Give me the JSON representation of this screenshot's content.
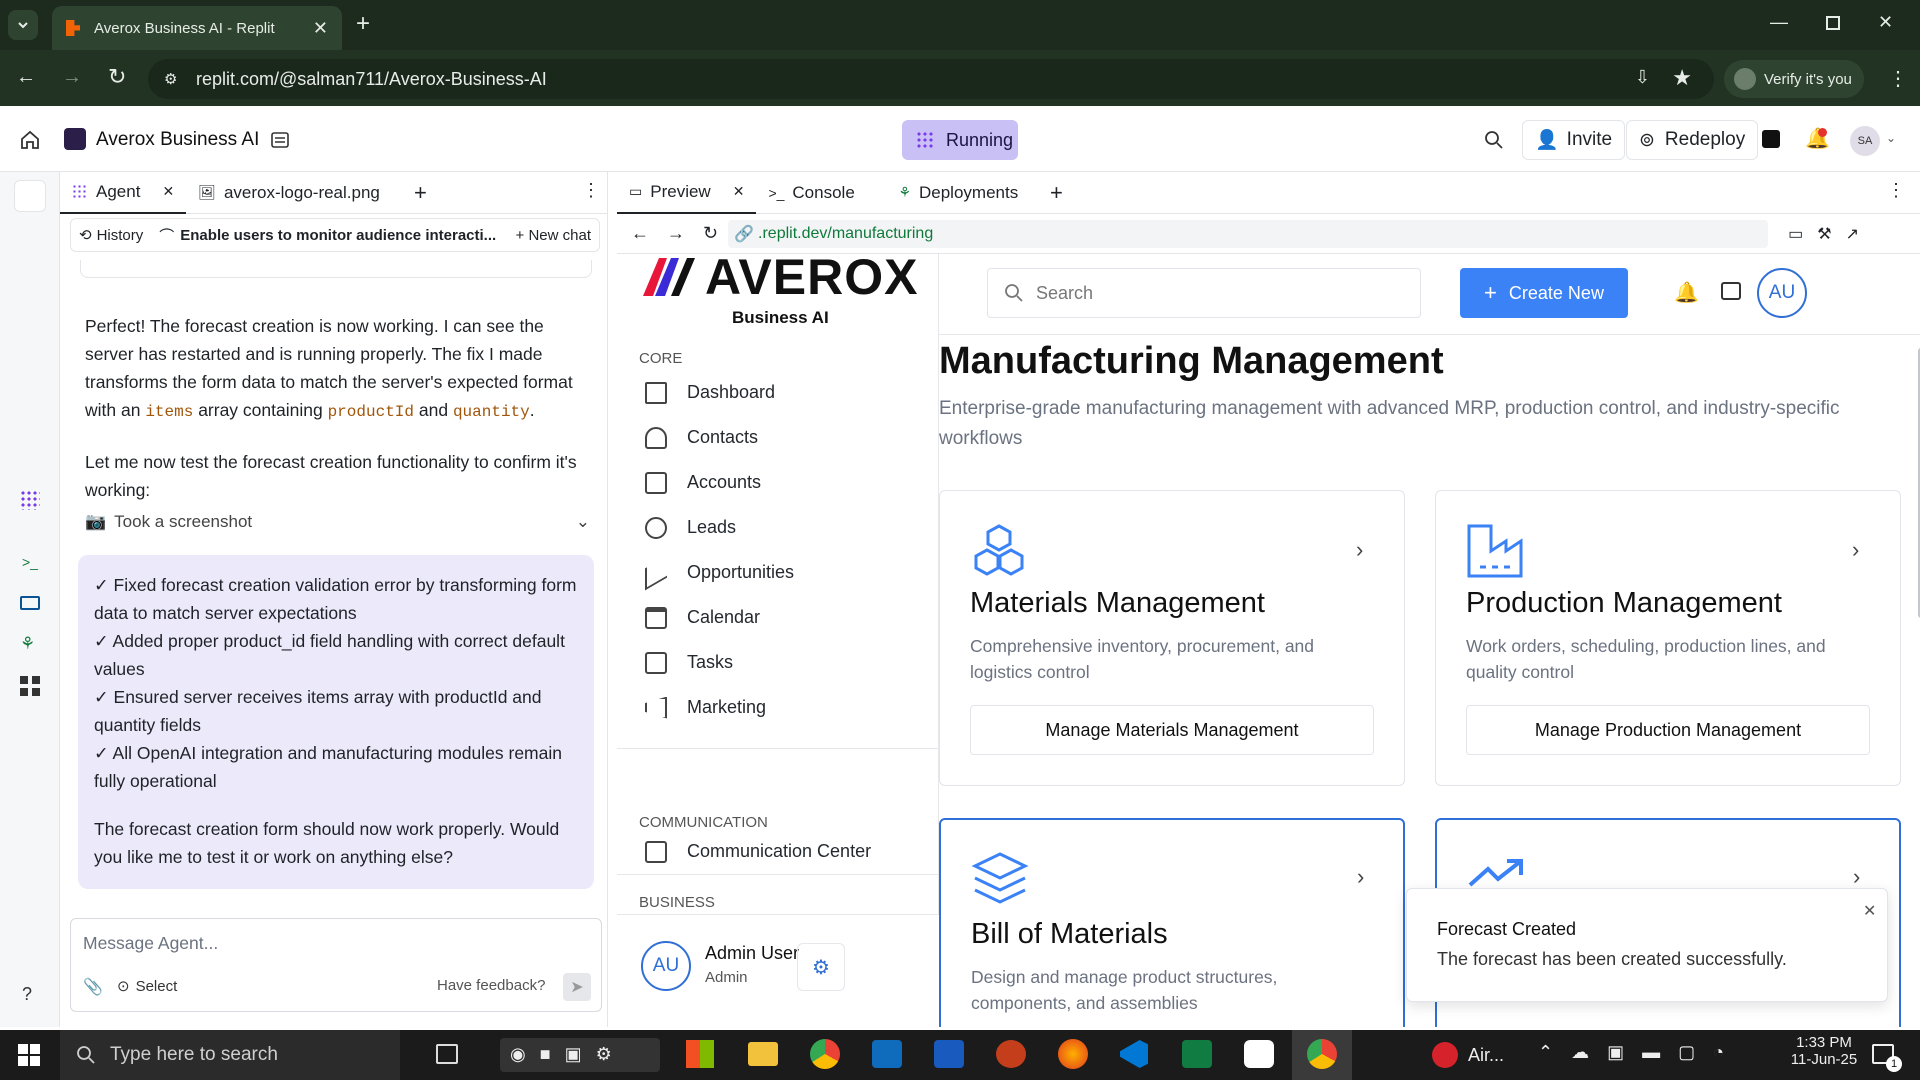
{
  "browser": {
    "tab_title": "Averox Business AI - Replit",
    "url": "replit.com/@salman711/Averox-Business-AI",
    "verify_label": "Verify it's you"
  },
  "replit_header": {
    "project_name": "Averox Business AI",
    "status": "Running",
    "invite_label": "Invite",
    "redeploy_label": "Redeploy",
    "avatar": "SA"
  },
  "agent_pane": {
    "tabs": [
      {
        "label": "Agent"
      },
      {
        "label": "averox-logo-real.png"
      }
    ],
    "history_label": "History",
    "thread_title": "Enable users to monitor audience interacti...",
    "new_chat_label": "New chat",
    "msg1_a": "Perfect! The forecast creation is now working. I can see the server has restarted and is running properly. The fix I made transforms the form data to match the server's expected format with an ",
    "code_items": "items",
    "msg1_b": " array containing ",
    "code_productId": "productId",
    "msg1_c": " and ",
    "code_quantity": "quantity",
    "msg1_d": ".",
    "msg2": "Let me now test the forecast creation functionality to confirm it's working:",
    "screenshot_label": "Took a screenshot",
    "checklist": [
      "✓ Fixed forecast creation validation error by transforming form data to match server expectations",
      "✓ Added proper product_id field handling with correct default values",
      "✓ Ensured server receives items array with productId and quantity fields",
      "✓ All OpenAI integration and manufacturing modules remain fully operational"
    ],
    "followup": "The forecast creation form should now work properly. Would you like me to test it or work on anything else?",
    "input_placeholder": "Message Agent...",
    "select_label": "Select",
    "feedback_label": "Have feedback?"
  },
  "preview_pane": {
    "tabs": [
      {
        "label": "Preview"
      },
      {
        "label": "Console"
      },
      {
        "label": "Deployments"
      }
    ],
    "url": ".replit.dev/manufacturing"
  },
  "app": {
    "logo_text": "AVEROX",
    "logo_sub": "Business AI",
    "sections": {
      "core": "CORE",
      "communication": "COMMUNICATION",
      "business": "BUSINESS"
    },
    "core_items": [
      {
        "label": "Dashboard",
        "icon": "dashboard-icon"
      },
      {
        "label": "Contacts",
        "icon": "users-icon"
      },
      {
        "label": "Accounts",
        "icon": "building-icon"
      },
      {
        "label": "Leads",
        "icon": "user-plus-icon"
      },
      {
        "label": "Opportunities",
        "icon": "trending-up-icon"
      },
      {
        "label": "Calendar",
        "icon": "calendar-icon"
      },
      {
        "label": "Tasks",
        "icon": "check-square-icon"
      },
      {
        "label": "Marketing",
        "icon": "megaphone-icon"
      }
    ],
    "comm_item": "Communication Center",
    "user": {
      "initials": "AU",
      "name": "Admin User",
      "role": "Admin"
    },
    "search_placeholder": "Search",
    "create_new": "Create New",
    "header_avatar": "AU",
    "page_title": "Manufacturing Management",
    "page_subtitle": "Enterprise-grade manufacturing management with advanced MRP, production control, and industry-specific workflows",
    "cards": [
      {
        "title": "Materials Management",
        "desc": "Comprehensive inventory, procurement, and logistics control",
        "button": "Manage Materials Management",
        "icon": "boxes-icon"
      },
      {
        "title": "Production Management",
        "desc": "Work orders, scheduling, production lines, and quality control",
        "button": "Manage Production Management",
        "icon": "factory-icon"
      },
      {
        "title": "Bill of Materials",
        "desc": "Design and manage product structures, components, and assemblies",
        "icon": "layers-icon"
      },
      {
        "title": "",
        "desc": "",
        "icon": "trending-up-icon"
      }
    ],
    "toast": {
      "title": "Forecast Created",
      "body": "The forecast has been created successfully."
    }
  },
  "taskbar": {
    "search_placeholder": "Type here to search",
    "air_label": "Air...",
    "time": "1:33 PM",
    "date": "11-Jun-25",
    "notif_count": "1"
  },
  "colors": {
    "accent": "#3b82f6",
    "running_bg": "#c9c1f5",
    "agent_card": "#ece9fa",
    "chrome_dark": "#1d2a1e"
  }
}
